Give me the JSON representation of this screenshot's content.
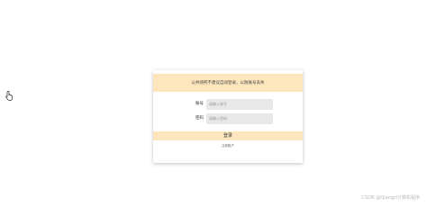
{
  "notice": {
    "text": "公共场所不建议自动登录，以防账号丢失"
  },
  "form": {
    "account_label": "账号",
    "account_placeholder": "请输入账号",
    "password_label": "密码",
    "password_placeholder": "请输入密码",
    "login_label": "登录",
    "register_label": "注册账户"
  },
  "watermark": {
    "text": "CSDN @Qiangzi计算机程序"
  },
  "colors": {
    "accent": "#fde6bd",
    "input_bg": "#e8e8e8"
  },
  "icons": {
    "cursor": "hand-pointer-icon"
  }
}
